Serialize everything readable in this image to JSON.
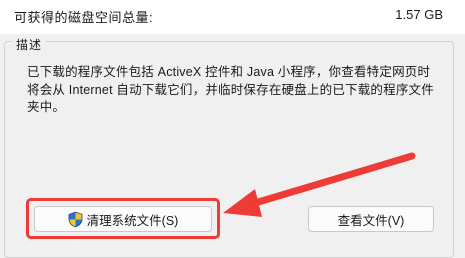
{
  "space": {
    "label": "可获得的磁盘空间总量:",
    "value": "1.57 GB"
  },
  "description": {
    "legend": "描述",
    "text": "已下载的程序文件包括 ActiveX 控件和 Java 小程序，你查看特定网页时将会从 Internet 自动下载它们，并临时保存在硬盘上的已下载的程序文件夹中。"
  },
  "buttons": {
    "clean_label": "清理系统文件(S)",
    "view_label": "查看文件(V)"
  },
  "icons": {
    "shield": "uac-shield-icon",
    "arrow": "annotation-arrow"
  },
  "colors": {
    "annotation": "#ee3b36",
    "shield_blue": "#2f73c8",
    "shield_yellow": "#f2c530"
  }
}
